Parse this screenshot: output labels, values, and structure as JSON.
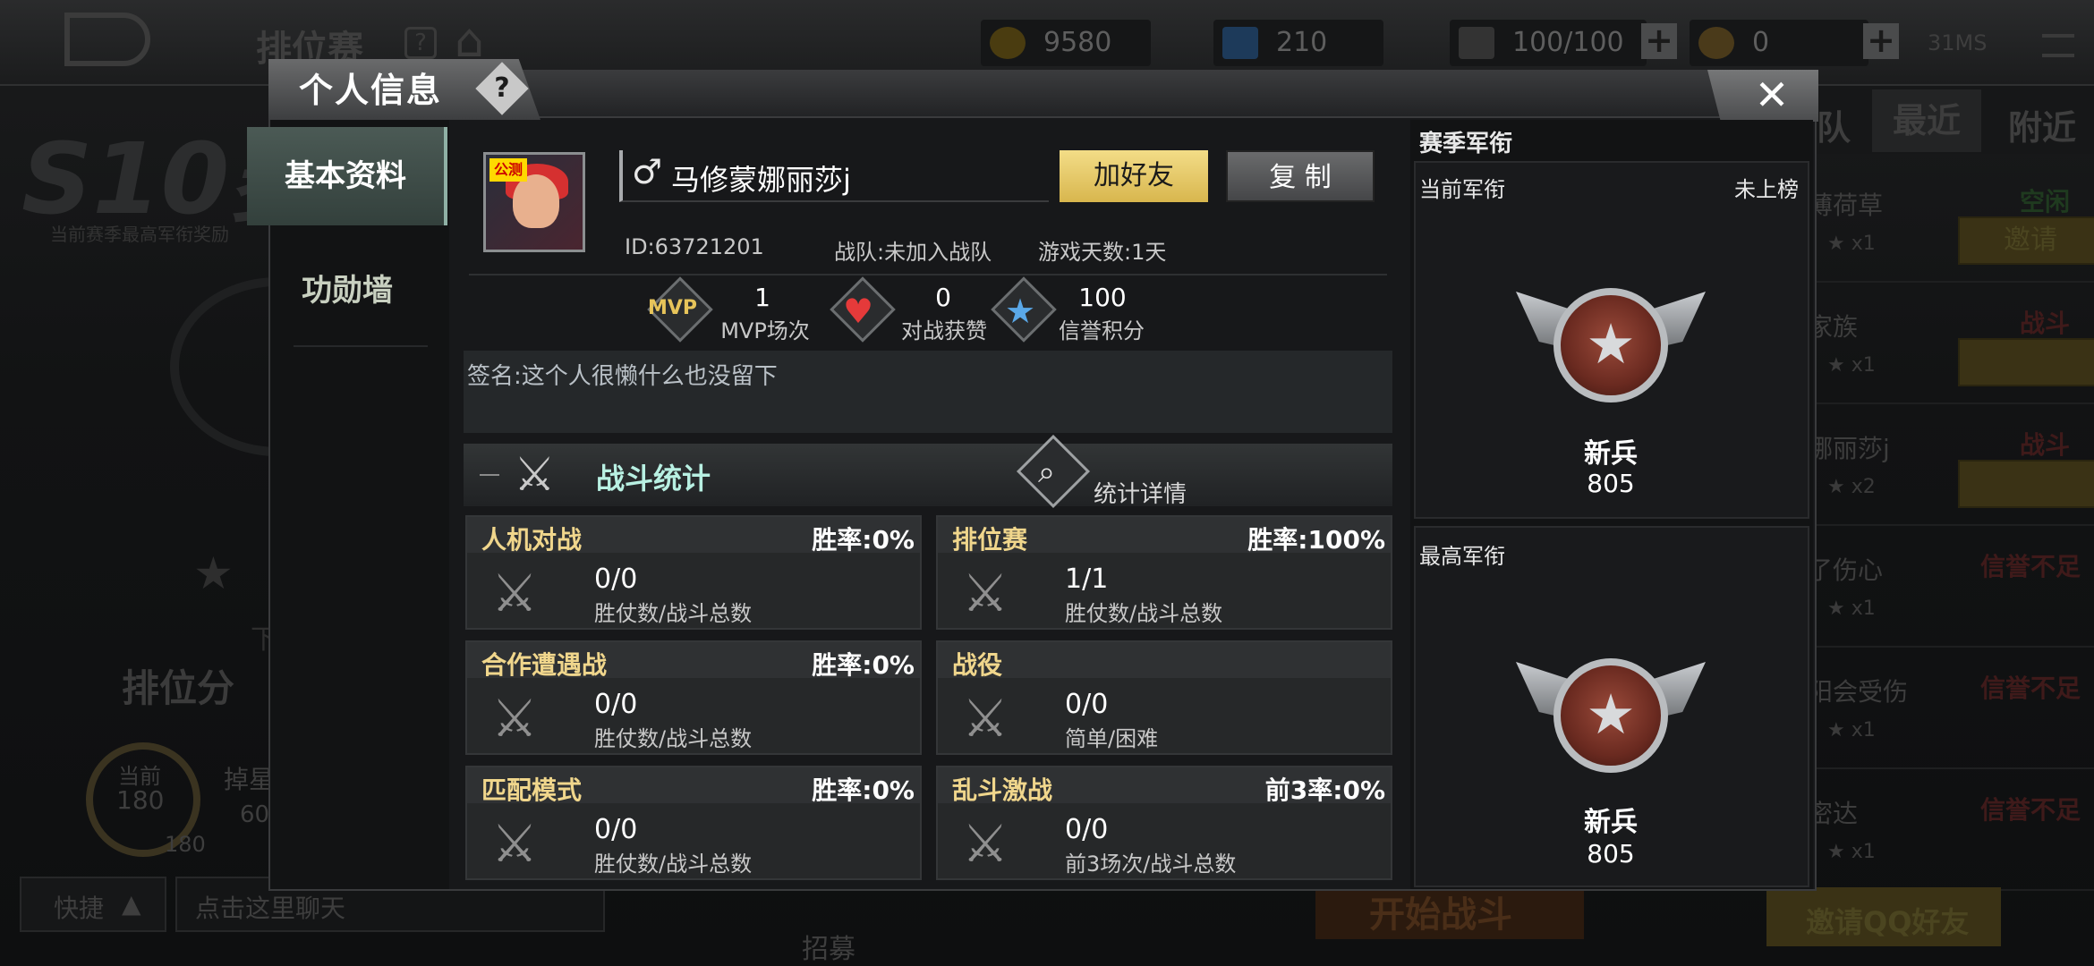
{
  "background": {
    "back_label": "",
    "mode_title": "排位赛",
    "season_label": "S10赛",
    "season_sub": "当前赛季最高军衔奖励",
    "resources": [
      "9580",
      "210",
      "100/100",
      "0"
    ],
    "ping": "31MS",
    "right_tabs": [
      "队",
      "最近",
      "附近"
    ],
    "friends": [
      {
        "name": "薄荷草",
        "status": "空闲",
        "button": "邀请",
        "stars": "x1"
      },
      {
        "name": "家族",
        "status": "战斗",
        "button": "",
        "stars": "x1"
      },
      {
        "name": "娜丽莎j",
        "status": "战斗",
        "button": "",
        "stars": "x2"
      },
      {
        "name": "了伤心",
        "status": "信誉不足",
        "button": "",
        "stars": "x1"
      },
      {
        "name": "阳会受伤",
        "status": "信誉不足",
        "button": "",
        "stars": "x1"
      },
      {
        "name": "密达",
        "status": "信誉不足",
        "button": "",
        "stars": "x1"
      }
    ],
    "rank_points_label": "排位分",
    "current_label": "当前",
    "current_value": "180",
    "drop_label": "掉星",
    "drop_value": "60",
    "small_180": "180",
    "quick_label": "快捷",
    "chat_placeholder": "点击这里聊天",
    "recruit_label": "招募",
    "start_label": "开始战斗",
    "invite_qq": "邀请QQ好友",
    "lower_label": "下"
  },
  "dialog": {
    "title": "个人信息",
    "help": "?",
    "close": "✕",
    "nav": [
      "基本资料",
      "功勋墙"
    ],
    "profile": {
      "badge": "公测",
      "gender": "♂",
      "name": "马修蒙娜丽莎j",
      "add_friend": "加好友",
      "copy": "复 制",
      "id_text": "ID:63721201",
      "team_text": "战队:未加入战队",
      "days_text": "游戏天数:1天"
    },
    "stats": [
      {
        "icon": "MVP",
        "value": "1",
        "label": "MVP场次"
      },
      {
        "icon": "heart",
        "value": "0",
        "label": "对战获赞"
      },
      {
        "icon": "star",
        "value": "100",
        "label": "信誉积分"
      }
    ],
    "signature": "签名:这个人很懒什么也没留下",
    "battle_title": "战斗统计",
    "detail_label": "统计详情",
    "cards": [
      {
        "title": "人机对战",
        "rate": "胜率:0%",
        "value": "0/0",
        "sub": "胜仗数/战斗总数"
      },
      {
        "title": "排位赛",
        "rate": "胜率:100%",
        "value": "1/1",
        "sub": "胜仗数/战斗总数"
      },
      {
        "title": "合作遭遇战",
        "rate": "胜率:0%",
        "value": "0/0",
        "sub": "胜仗数/战斗总数"
      },
      {
        "title": "战役",
        "rate": "",
        "value": "0/0",
        "sub": "简单/困难"
      },
      {
        "title": "匹配模式",
        "rate": "胜率:0%",
        "value": "0/0",
        "sub": "胜仗数/战斗总数"
      },
      {
        "title": "乱斗激战",
        "rate": "前3率:0%",
        "value": "0/0",
        "sub": "前3场次/战斗总数"
      }
    ],
    "rank": {
      "section_title": "赛季军衔",
      "current_label": "当前军衔",
      "current_status": "未上榜",
      "current_name": "新兵",
      "current_value": "805",
      "highest_label": "最高军衔",
      "highest_name": "新兵",
      "highest_value": "805"
    }
  }
}
